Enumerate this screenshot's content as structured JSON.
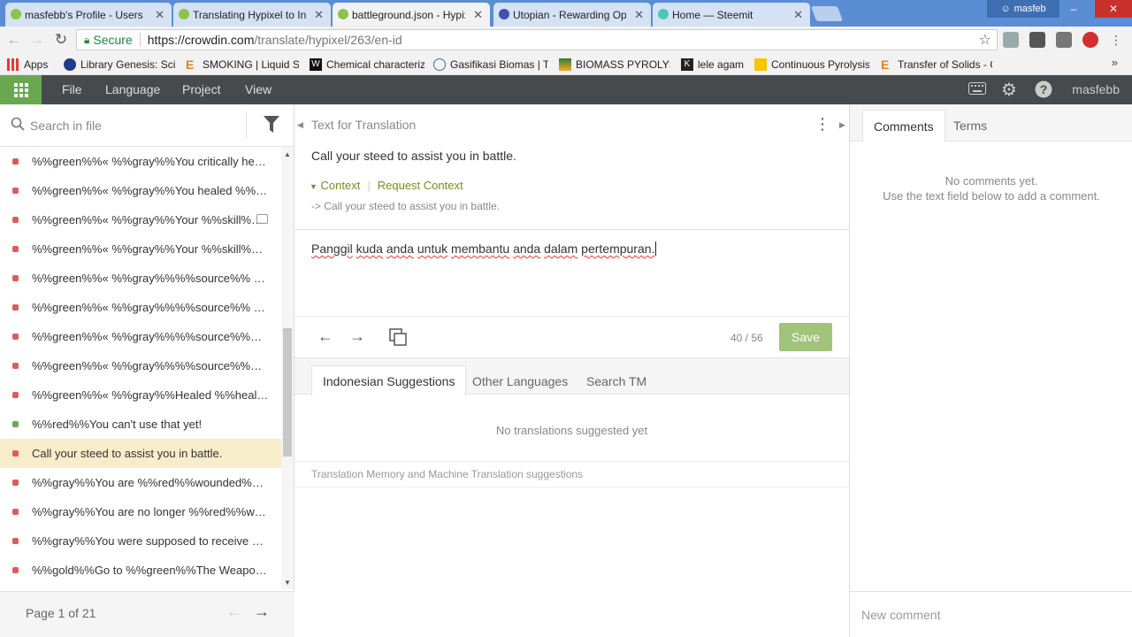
{
  "browser": {
    "tabs": [
      {
        "label": "masfebb's Profile - Users",
        "active": false
      },
      {
        "label": "Translating Hypixel to Indonesian",
        "active": false
      },
      {
        "label": "battleground.json - Hypixel",
        "active": true
      },
      {
        "label": "Utopian - Rewarding Open Source",
        "active": false
      },
      {
        "label": "Home — Steemit",
        "active": false
      }
    ],
    "profile_name": "masfeb",
    "secure_label": "Secure",
    "url_host": "https://crowdin.com",
    "url_path": "/translate/hypixel/263/en-id",
    "bookmarks": [
      "Apps",
      "Library Genesis: Scientific",
      "SMOKING | Liquid Smoke",
      "Chemical characterization",
      "Gasifikasi Biomas | Te",
      "BIOMASS PYROLYSIS",
      "lele agam",
      "Continuous Pyrolysis",
      "Transfer of Solids - C"
    ]
  },
  "menubar": {
    "items": [
      "File",
      "Language",
      "Project",
      "View"
    ],
    "user": "masfebb"
  },
  "sidebar": {
    "search_placeholder": "Search in file",
    "strings": [
      {
        "text": "%%green%%« %%gray%%You critically healed...",
        "status": "untranslated"
      },
      {
        "text": "%%green%%« %%gray%%You healed %%targ...",
        "status": "untranslated"
      },
      {
        "text": "%%green%%« %%gray%%Your %%skill%%...",
        "status": "untranslated",
        "comment": true
      },
      {
        "text": "%%green%%« %%gray%%Your %%skill%% he...",
        "status": "untranslated"
      },
      {
        "text": "%%green%%« %%gray%%%%source%% critic...",
        "status": "untranslated"
      },
      {
        "text": "%%green%%« %%gray%%%%source%% heale...",
        "status": "untranslated"
      },
      {
        "text": "%%green%%« %%gray%%%%source%%%%sk...",
        "status": "untranslated"
      },
      {
        "text": "%%green%%« %%gray%%%%source%%%%sk...",
        "status": "untranslated"
      },
      {
        "text": "%%green%%« %%gray%%Healed %%health%%",
        "status": "untranslated"
      },
      {
        "text": "%%red%%You can't use that yet!",
        "status": "translated"
      },
      {
        "text": "Call your steed to assist you in battle.",
        "status": "untranslated",
        "selected": true
      },
      {
        "text": "%%gray%%You are %%red%%wounded%%gr...",
        "status": "untranslated"
      },
      {
        "text": "%%gray%%You are no longer %%red%%woun...",
        "status": "untranslated"
      },
      {
        "text": "%%gray%%You were supposed to receive %%...",
        "status": "untranslated"
      },
      {
        "text": "%%gold%%Go to %%green%%The Weapons...",
        "status": "untranslated"
      }
    ],
    "pager_text": "Page 1 of 21"
  },
  "editor": {
    "source_heading": "Text for Translation",
    "source_text": "Call your steed to assist you in battle.",
    "context_label": "Context",
    "request_context_label": "Request Context",
    "context_note": "-> Call your steed to assist you in battle.",
    "translation_words": [
      "Panggil",
      "kuda",
      "anda",
      "untuk",
      "membantu",
      "anda",
      "dalam",
      "pertempuran."
    ],
    "counter": "40 / 56",
    "save_label": "Save",
    "suggestion_tabs": [
      "Indonesian Suggestions",
      "Other Languages",
      "Search TM"
    ],
    "no_suggestions": "No translations suggested yet",
    "tm_note": "Translation Memory and Machine Translation suggestions"
  },
  "comments": {
    "tabs": [
      "Comments",
      "Terms"
    ],
    "empty_line1": "No comments yet.",
    "empty_line2": "Use the text field below to add a comment.",
    "new_comment_placeholder": "New comment"
  },
  "colors": {
    "crowdin_green": "#6aa84f",
    "menubar_bg": "#474a4d",
    "context_olive": "#7a8a22",
    "selected_row": "#f7edca",
    "status_untranslated": "#e05a5a",
    "status_translated": "#6aa84f",
    "save_button": "#a1c37a"
  },
  "icons": [
    "grid-icon",
    "filter-icon",
    "search-icon",
    "arrow-left-icon",
    "arrow-right-icon",
    "copy-source-icon",
    "keyboard-icon",
    "gear-icon",
    "help-icon",
    "kebab-menu-icon"
  ]
}
